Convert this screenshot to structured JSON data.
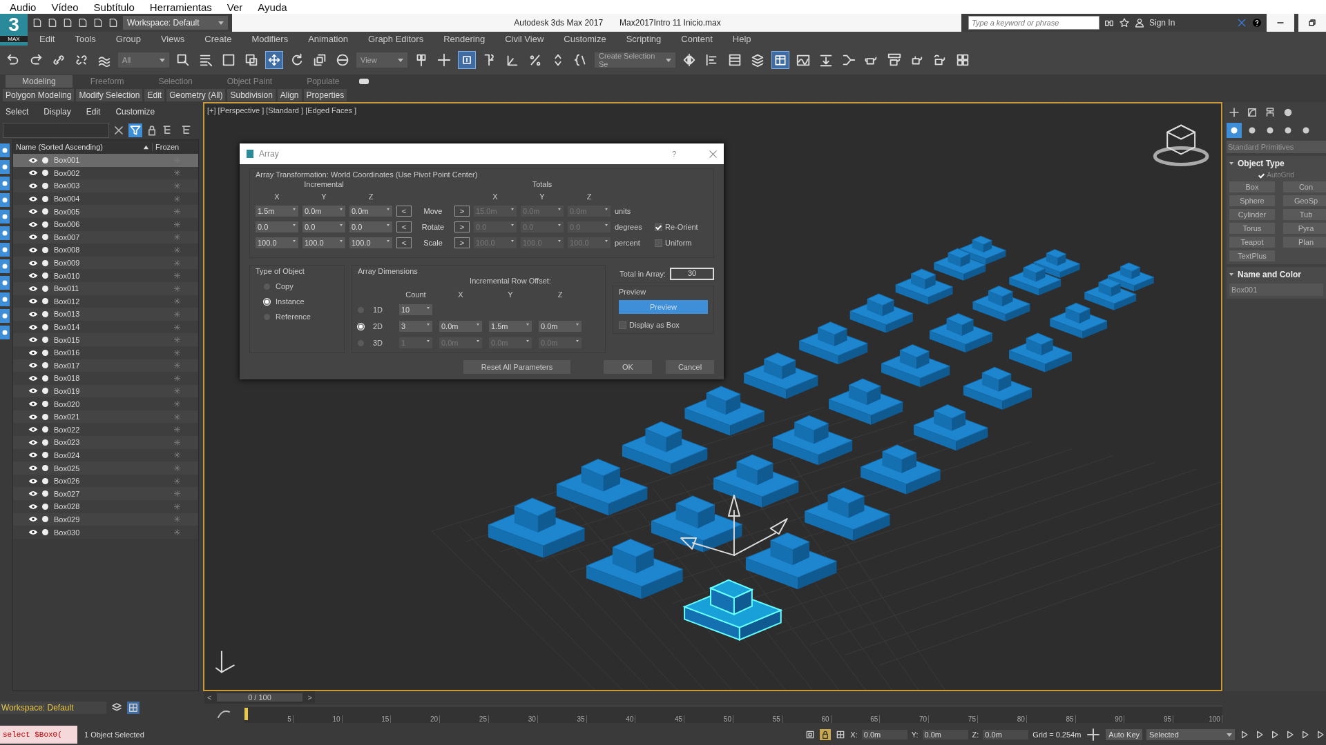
{
  "os_menu": [
    "Audio",
    "Vídeo",
    "Subtítulo",
    "Herramientas",
    "Ver",
    "Ayuda"
  ],
  "title_bar": {
    "logo_digit": "3",
    "logo_text": "MAX",
    "workspace": "Workspace: Default",
    "app_title": "Autodesk 3ds Max 2017",
    "file_name": "Max2017Intro 11 Inicio.max",
    "search_placeholder": "Type a keyword or phrase",
    "sign_in": "Sign In"
  },
  "menu_bar": [
    "Edit",
    "Tools",
    "Group",
    "Views",
    "Create",
    "Modifiers",
    "Animation",
    "Graph Editors",
    "Rendering",
    "Civil View",
    "Customize",
    "Scripting",
    "Content",
    "Help"
  ],
  "toolbar": {
    "selection_filter": "All",
    "reference_coord": "View",
    "selection_set": "Create Selection Se"
  },
  "ribbon_tabs": [
    {
      "label": "Modeling",
      "selected": true
    },
    {
      "label": "Freeform",
      "selected": false
    },
    {
      "label": "Selection",
      "selected": false
    },
    {
      "label": "Object Paint",
      "selected": false
    },
    {
      "label": "Populate",
      "selected": false
    }
  ],
  "ribbon_panels": [
    "Polygon Modeling",
    "Modify Selection",
    "Edit",
    "Geometry (All)",
    "Subdivision",
    "Align",
    "Properties"
  ],
  "scene_explorer": {
    "menu": [
      "Select",
      "Display",
      "Edit",
      "Customize"
    ],
    "columns": [
      "Name (Sorted Ascending)",
      "Frozen"
    ],
    "rows": [
      {
        "name": "Box001",
        "selected": true
      },
      {
        "name": "Box002",
        "selected": false
      },
      {
        "name": "Box003",
        "selected": false
      },
      {
        "name": "Box004",
        "selected": false
      },
      {
        "name": "Box005",
        "selected": false
      },
      {
        "name": "Box006",
        "selected": false
      },
      {
        "name": "Box007",
        "selected": false
      },
      {
        "name": "Box008",
        "selected": false
      },
      {
        "name": "Box009",
        "selected": false
      },
      {
        "name": "Box010",
        "selected": false
      },
      {
        "name": "Box011",
        "selected": false
      },
      {
        "name": "Box012",
        "selected": false
      },
      {
        "name": "Box013",
        "selected": false
      },
      {
        "name": "Box014",
        "selected": false
      },
      {
        "name": "Box015",
        "selected": false
      },
      {
        "name": "Box016",
        "selected": false
      },
      {
        "name": "Box017",
        "selected": false
      },
      {
        "name": "Box018",
        "selected": false
      },
      {
        "name": "Box019",
        "selected": false
      },
      {
        "name": "Box020",
        "selected": false
      },
      {
        "name": "Box021",
        "selected": false
      },
      {
        "name": "Box022",
        "selected": false
      },
      {
        "name": "Box023",
        "selected": false
      },
      {
        "name": "Box024",
        "selected": false
      },
      {
        "name": "Box025",
        "selected": false
      },
      {
        "name": "Box026",
        "selected": false
      },
      {
        "name": "Box027",
        "selected": false
      },
      {
        "name": "Box028",
        "selected": false
      },
      {
        "name": "Box029",
        "selected": false
      },
      {
        "name": "Box030",
        "selected": false
      }
    ]
  },
  "viewport": {
    "label": "[+] [Perspective ] [Standard ] [Edged Faces ]"
  },
  "dialog": {
    "title": "Array",
    "help": "?",
    "transform_heading": "Array Transformation: World Coordinates (Use Pivot Point Center)",
    "incremental_label": "Incremental",
    "totals_label": "Totals",
    "incremental_axes": [
      "X",
      "Y",
      "Z"
    ],
    "totals_axes": [
      "X",
      "Y",
      "Z"
    ],
    "rows": [
      {
        "label": "Move",
        "left": "<",
        "right": ">",
        "incremental": [
          "1.5m",
          "0.0m",
          "0.0m"
        ],
        "totals": [
          "15.0m",
          "0.0m",
          "0.0m"
        ],
        "unit": "units"
      },
      {
        "label": "Rotate",
        "left": "<",
        "right": ">",
        "incremental": [
          "0.0",
          "0.0",
          "0.0"
        ],
        "totals": [
          "0.0",
          "0.0",
          "0.0"
        ],
        "unit": "degrees",
        "option": {
          "label": "Re-Orient",
          "checked": true
        }
      },
      {
        "label": "Scale",
        "left": "<",
        "right": ">",
        "incremental": [
          "100.0",
          "100.0",
          "100.0"
        ],
        "totals": [
          "100.0",
          "100.0",
          "100.0"
        ],
        "unit": "percent",
        "option": {
          "label": "Uniform",
          "checked": false
        }
      }
    ],
    "type_of_object": {
      "title": "Type of Object",
      "options": [
        {
          "label": "Copy",
          "selected": false
        },
        {
          "label": "Instance",
          "selected": true
        },
        {
          "label": "Reference",
          "selected": false
        }
      ]
    },
    "array_dimensions": {
      "title": "Array Dimensions",
      "count_label": "Count",
      "offset_label": "Incremental Row Offset:",
      "axes": [
        "X",
        "Y",
        "Z"
      ],
      "rows": [
        {
          "label": "1D",
          "selected": false,
          "disabled": false,
          "count": "10"
        },
        {
          "label": "2D",
          "selected": true,
          "disabled": false,
          "count": "3",
          "offsets": [
            "0.0m",
            "1.5m",
            "0.0m"
          ]
        },
        {
          "label": "3D",
          "selected": false,
          "disabled": true,
          "count": "1",
          "offsets": [
            "0.0m",
            "0.0m",
            "0.0m"
          ]
        }
      ]
    },
    "total_label": "Total in Array:",
    "total_value": "30",
    "preview": {
      "title": "Preview",
      "button": "Preview",
      "display_as_box": {
        "label": "Display as Box",
        "checked": false
      }
    },
    "buttons": [
      "Reset All Parameters",
      "OK",
      "Cancel"
    ]
  },
  "command_panel": {
    "dropdown": "Standard Primitives",
    "object_type": "Object Type",
    "autogrid": {
      "label": "AutoGrid",
      "checked": true
    },
    "buttons": [
      "Box",
      "Con",
      "Sphere",
      "GeoSp",
      "Cylinder",
      "Tub",
      "Torus",
      "Pyra",
      "Teapot",
      "Plan",
      "TextPlus"
    ],
    "name_and_color": "Name and Color",
    "name_value": "Box001"
  },
  "timeline": {
    "workspace": "Workspace: Default",
    "prev": "<",
    "frame": "0 / 100",
    "next": ">",
    "ticks": [
      "5",
      "10",
      "15",
      "20",
      "25",
      "30",
      "35",
      "40",
      "45",
      "50",
      "55",
      "60",
      "65",
      "70",
      "75",
      "80",
      "85",
      "90",
      "95",
      "100"
    ]
  },
  "status_bar": {
    "script": "select $Box0(",
    "selection": "1 Object Selected",
    "x_label": "X:",
    "x": "0.0m",
    "y_label": "Y:",
    "y": "0.0m",
    "z_label": "Z:",
    "z": "0.0m",
    "grid": "Grid = 0.254m",
    "auto_key": "Auto Key",
    "key_mode": "Selected"
  }
}
